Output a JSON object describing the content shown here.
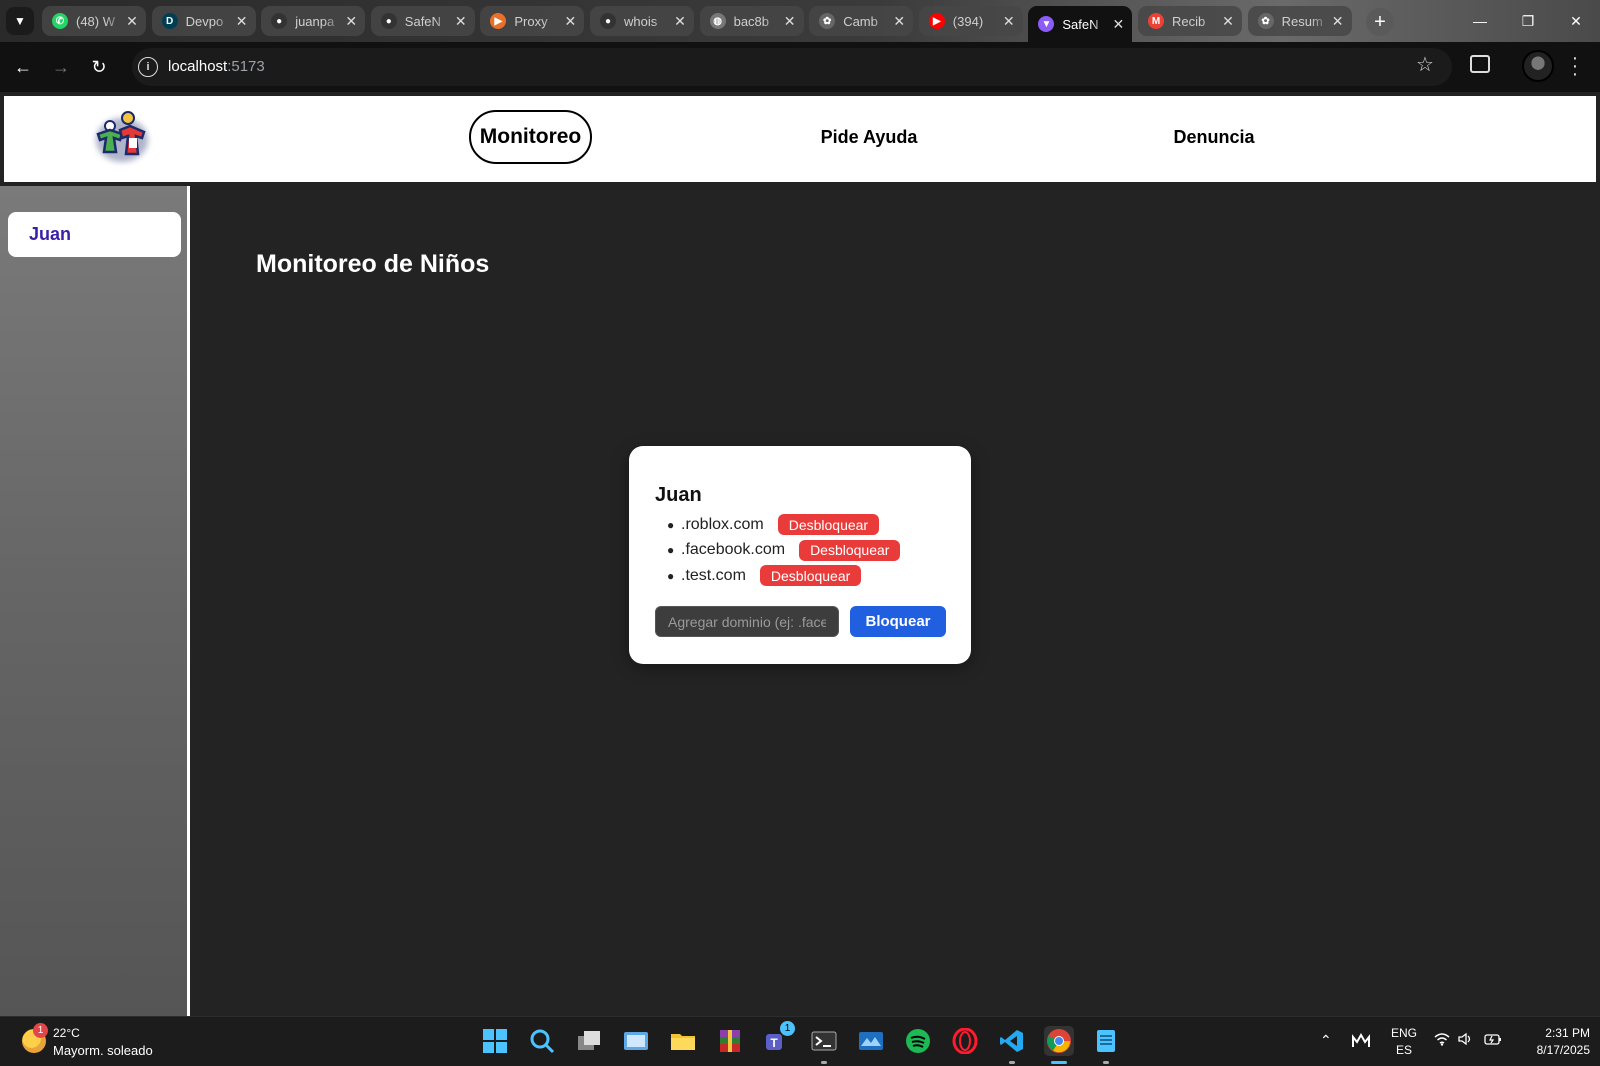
{
  "browser": {
    "tabs": [
      {
        "title": "(48) W",
        "icon": "whatsapp-icon",
        "color": "#25d366"
      },
      {
        "title": "Devpo",
        "icon": "devpost-icon",
        "color": "#003e54"
      },
      {
        "title": "juanpa",
        "icon": "github-icon",
        "color": "#333333"
      },
      {
        "title": "SafeN",
        "icon": "github-icon",
        "color": "#333333"
      },
      {
        "title": "Proxy",
        "icon": "proxy-icon",
        "color": "#e8702a"
      },
      {
        "title": "whois",
        "icon": "github-icon",
        "color": "#333333"
      },
      {
        "title": "bac8b",
        "icon": "globe-icon",
        "color": "#777777"
      },
      {
        "title": "Camb",
        "icon": "openai-icon",
        "color": "#666666"
      },
      {
        "title": "(394)",
        "icon": "youtube-icon",
        "color": "#ff0000"
      },
      {
        "title": "SafeN",
        "icon": "vite-icon",
        "color": "#8b5cf6",
        "active": true
      },
      {
        "title": "Recib",
        "icon": "gmail-icon",
        "color": "#ea4335"
      },
      {
        "title": "Resum",
        "icon": "openai-icon",
        "color": "#666666"
      }
    ],
    "url_host": "localhost",
    "url_port": ":5173"
  },
  "header": {
    "nav": [
      {
        "label": "Monitoreo",
        "active": true
      },
      {
        "label": "Pide Ayuda"
      },
      {
        "label": "Denuncia"
      }
    ]
  },
  "sidebar": {
    "children": [
      {
        "name": "Juan"
      }
    ]
  },
  "main": {
    "title": "Monitoreo de Niños",
    "card": {
      "name": "Juan",
      "domains": [
        ".roblox.com",
        ".facebook.com",
        ".test.com"
      ],
      "unblock_label": "Desbloquear",
      "input_placeholder": "Agregar dominio (ej: .facebook.com)",
      "block_label": "Bloquear"
    }
  },
  "taskbar": {
    "weather_temp": "22°C",
    "weather_desc": "Mayorm. soleado",
    "weather_badge": "1",
    "teams_badge": "1",
    "lang_top": "ENG",
    "lang_bottom": "ES",
    "time": "2:31 PM",
    "date": "8/17/2025"
  },
  "colors": {
    "unblock": "#ea3b3b",
    "block": "#1f5fe0",
    "sidebar_active_text": "#3b1fa8"
  }
}
